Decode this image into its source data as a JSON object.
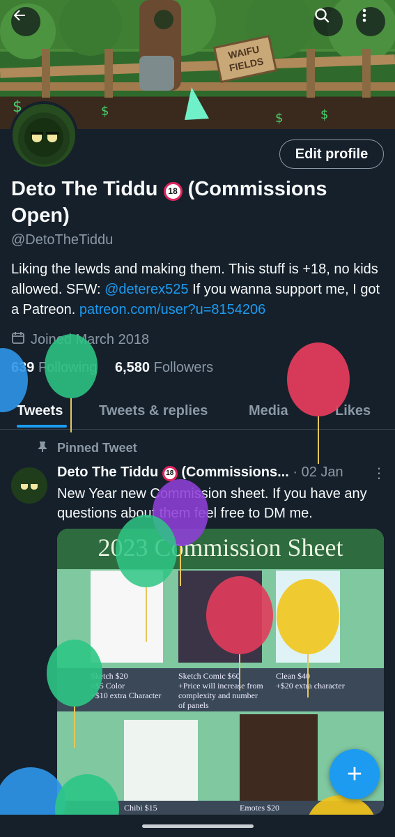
{
  "banner": {
    "sign_text_1": "WAIFU",
    "sign_text_2": "FIELDS"
  },
  "nav": {
    "back_icon": "arrow-left-icon",
    "search_icon": "search-icon",
    "more_icon": "more-vertical-icon"
  },
  "profile": {
    "edit_label": "Edit profile",
    "name": "Deto The Tiddu",
    "name_suffix": "(Commissions Open)",
    "badge": "18",
    "handle": "@DetoTheTiddu",
    "bio_text_1": "Liking the lewds and making them. This stuff is +18, no kids allowed. SFW: ",
    "bio_mention": "@deterex525",
    "bio_text_2": " If you wanna support me, I got a Patreon. ",
    "bio_link": "patreon.com/user?u=8154206",
    "joined": "Joined March 2018",
    "following_count": "639",
    "following_label": "Following",
    "followers_count": "6,580",
    "followers_label": "Followers"
  },
  "tabs": [
    {
      "label": "Tweets"
    },
    {
      "label": "Tweets & replies"
    },
    {
      "label": "Media"
    },
    {
      "label": "Likes"
    }
  ],
  "tweet": {
    "pinned_label": "Pinned Tweet",
    "author": "Deto The Tiddu",
    "author_suffix": "(Commissions...",
    "date": "· 02 Jan",
    "text": "New Year new Commission sheet. If you have any questions about them feel free to DM me.",
    "sheet": {
      "title": "2023 Commission Sheet",
      "cap_sketch": "Sketch $20\n+$5 Color\n+$10 extra Character",
      "cap_comic": "Sketch Comic $60\n+Price will increase from\ncomplexity and number\nof panels",
      "cap_clean": "Clean $40\n+$20 extra character",
      "cap_chibi": "Chibi $15",
      "cap_emotes": "Emotes $20"
    }
  },
  "fab": {
    "label": "+"
  },
  "colors": {
    "accent": "#1d9bf0",
    "background": "#15202b",
    "muted": "#8b98a5"
  }
}
